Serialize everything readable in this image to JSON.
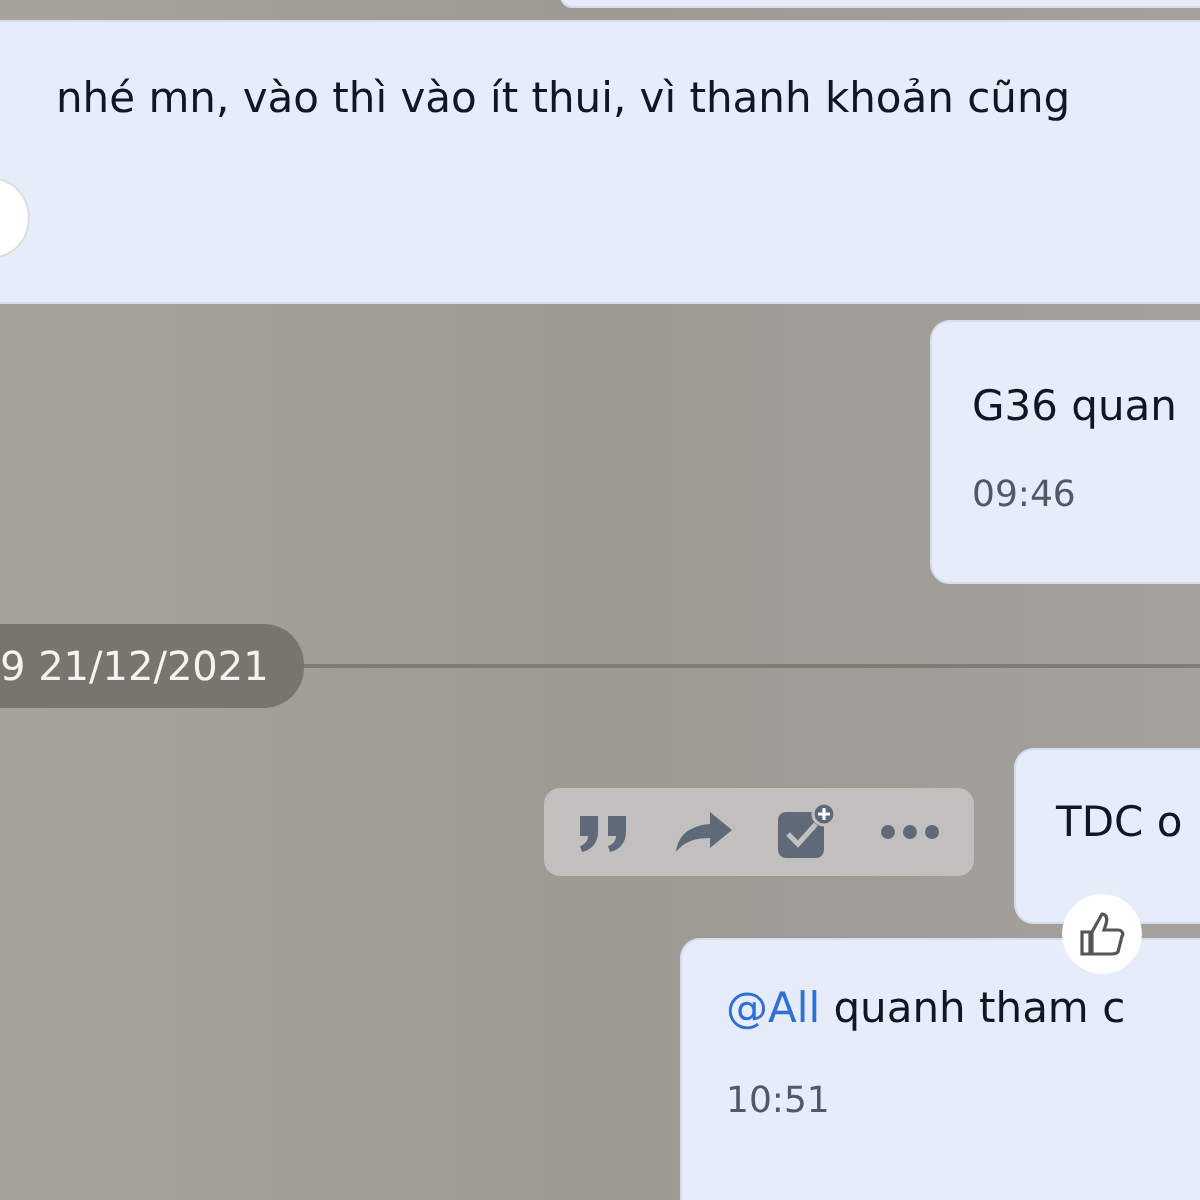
{
  "messages": [
    {
      "kind": "sliver"
    },
    {
      "kind": "received",
      "text": "nhé mn, vào thì vào ít thui, vì thanh khoản cũng",
      "reaction_button": true
    },
    {
      "kind": "sent",
      "text": "G36 quan",
      "time": "09:46"
    },
    {
      "kind": "divider",
      "text": "9 21/12/2021"
    },
    {
      "kind": "sent",
      "text": "TDC o",
      "hovered": true,
      "liked": true
    },
    {
      "kind": "sent",
      "mention": "@All",
      "text": "quanh tham c",
      "time": "10:51"
    }
  ],
  "actions": [
    {
      "kind": "quote"
    },
    {
      "kind": "forward"
    },
    {
      "kind": "task"
    },
    {
      "kind": "more"
    }
  ]
}
